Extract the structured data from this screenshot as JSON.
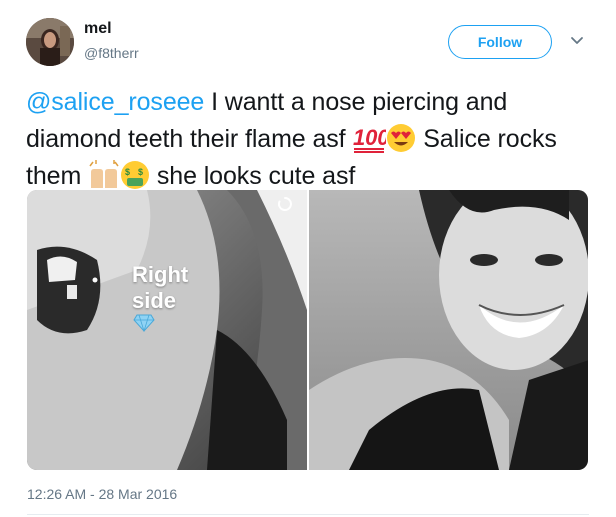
{
  "author": {
    "name": "mel",
    "handle": "@f8therr"
  },
  "follow_label": "Follow",
  "tweet": {
    "mention": "@salice_roseee",
    "text_part1": " I wantt a nose piercing and diamond teeth their flame asf ",
    "text_part2": " Salice rocks them ",
    "text_part3": " she looks cute asf",
    "emojis": [
      "hundred-points-emoji",
      "heart-eyes-emoji",
      "raising-hands-emoji",
      "money-mouth-emoji"
    ]
  },
  "media": {
    "left_overlay_line1": "Right",
    "left_overlay_line2": "side"
  },
  "timestamp": "12:26 AM - 28 Mar 2016",
  "colors": {
    "accent": "#1da1f2",
    "text": "#14171a",
    "secondary": "#657786"
  }
}
